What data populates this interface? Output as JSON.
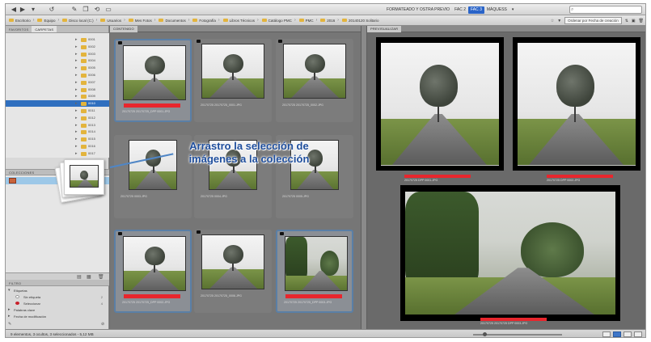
{
  "app": {
    "workspaces": [
      "FORMATEADO Y OSTRA PREVIO",
      "FAC 2",
      "FAC 3",
      "MÁQUESS"
    ],
    "active_workspace": 2,
    "search_placeholder": ""
  },
  "pathbar": {
    "crumbs": [
      "Escritorio",
      "Equipo",
      "Disco local (C:)",
      "Usuarios",
      "Mes Fotos",
      "Documentos",
      "Fotografía",
      "Libros Técnicos",
      "Catálogo PMC",
      "PMC",
      "2016",
      "20140120 Solitario"
    ],
    "sort_label": "Ordenar por Fecha de creación"
  },
  "left_panel": {
    "tabs": [
      "Favoritos",
      "Carpetas"
    ],
    "active_tab": 1,
    "tree_items": [
      "0001",
      "0002",
      "0003",
      "0004",
      "0005",
      "0006",
      "0007",
      "0008",
      "0009",
      "0010",
      "0011",
      "0012",
      "0013",
      "0014",
      "0015",
      "0016",
      "0017"
    ],
    "selected_item": 9,
    "collections_tab": "Colecciones",
    "metadata": {
      "tab": "Filtro",
      "rows": [
        {
          "label": "Etiquetas",
          "count": ""
        },
        {
          "label": "Sin etiqueta",
          "count": "2"
        },
        {
          "label": "Seleccionar",
          "count": "4"
        },
        {
          "label": "Palabras clave",
          "count": ""
        },
        {
          "label": "Fecha de modificación",
          "count": ""
        }
      ]
    }
  },
  "content": {
    "tab": "Contenido",
    "items": [
      {
        "caption": "20170725 20170725_DPP 0001.JPG",
        "selected": true,
        "red": true
      },
      {
        "caption": "20170725 20170725_0001.JPG",
        "selected": false,
        "red": false
      },
      {
        "caption": "20170725 20170725_0002.JPG",
        "selected": false,
        "red": false
      },
      {
        "caption": "20170725 0003.JPG",
        "selected": false,
        "red": false
      },
      {
        "caption": "20170725 0004.JPG",
        "selected": false,
        "red": false
      },
      {
        "caption": "20170725 0005.JPG",
        "selected": false,
        "red": false
      },
      {
        "caption": "20170725 20170725_DPP 0002.JPG",
        "selected": true,
        "red": true
      },
      {
        "caption": "20170725 20170725_0006.JPG",
        "selected": false,
        "red": false
      },
      {
        "caption": "20170725 20170725_DPP 0003.JPG",
        "selected": true,
        "red": true
      }
    ]
  },
  "preview": {
    "tab": "Previsualizar",
    "captions": [
      "20170725 DPP 0001.JPG",
      "20170725 DPP 0002.JPG",
      "20170725 20170725 DPP 0003.JPG"
    ]
  },
  "status": {
    "text": "9 elementos, 3 ocultos, 3 seleccionados - 5,12 MB"
  },
  "overlay": {
    "line1": "Arrastro la selección de",
    "line2": "imágenes a la colección"
  },
  "colors": {
    "accent": "#2a64c8",
    "label_red": "#e8262d",
    "selection_blue": "#2f6fbf"
  }
}
